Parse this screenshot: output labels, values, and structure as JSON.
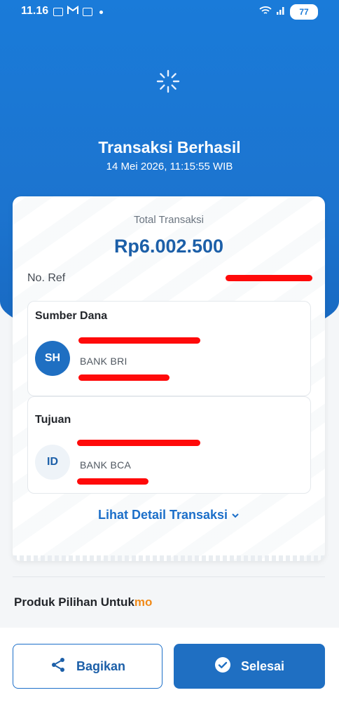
{
  "status_bar": {
    "time": "11.16",
    "battery": "77"
  },
  "header": {
    "title": "Transaksi Berhasil",
    "timestamp": "14 Mei 2026, 11:15:55 WIB"
  },
  "receipt": {
    "total_label": "Total Transaksi",
    "total_amount": "Rp6.002.500",
    "ref_label": "No. Ref",
    "source": {
      "section_label": "Sumber Dana",
      "initials": "SH",
      "bank": "BANK BRI"
    },
    "destination": {
      "section_label": "Tujuan",
      "initials": "ID",
      "bank": "BANK BCA"
    },
    "detail_link": "Lihat Detail Transaksi"
  },
  "promo": {
    "title": "Produk Pilihan Untuk",
    "brand": "mo"
  },
  "actions": {
    "share_label": "Bagikan",
    "done_label": "Selesai"
  },
  "colors": {
    "primary": "#1a7bd9",
    "amount": "#1c5fa8",
    "brand_orange": "#f08a19",
    "redaction": "#ff0a0a"
  }
}
